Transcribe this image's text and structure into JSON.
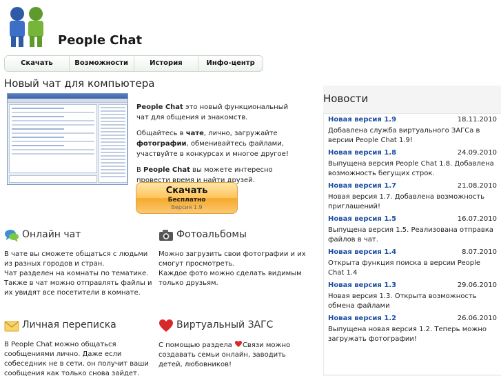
{
  "header": {
    "site_title": "People Chat"
  },
  "nav": {
    "items": [
      "Скачать",
      "Возможности",
      "История",
      "Инфо-центр"
    ]
  },
  "page_heading": "Новый чат для компьютера",
  "intro": {
    "p1_strong": "People Chat",
    "p1_rest": " это новый функциональный чат для общения и знакомств.",
    "p2_a": "Общайтесь в ",
    "p2_b": "чате",
    "p2_c": ", лично, загружайте ",
    "p2_d": "фотографии",
    "p2_e": ", обменивайтесь файлами, участвуйте в конкурсах и многое другое!",
    "p3_a": "В ",
    "p3_b": "People Chat",
    "p3_c": " вы можете интересно провести время и найти друзей."
  },
  "download": {
    "main": "Скачать",
    "sub": "Бесплатно",
    "version": "Версия 1.9"
  },
  "features": {
    "chat": {
      "title": "Онлайн чат",
      "text": "В чате вы сможете общаться с людьми из разных городов и стран.\nЧат разделен на комнаты по тематике.\nТакже в чат можно отправлять файлы и их увидят все посетители в комнате."
    },
    "photos": {
      "title": "Фотоальбомы",
      "text": "Можно загрузить свои фотографии и их смогут просмотреть.\nКаждое фото можно сделать видимым только друзьям."
    },
    "mail": {
      "title": "Личная переписка",
      "text": "В People Chat можно общаться сообщениями лично. Даже если собеседник не в сети, он получит ваши сообщения как только снова зайдет."
    },
    "zags": {
      "title": "Виртуальный ЗАГС",
      "text_a": "С помощью раздела ",
      "text_b": "Связи можно создавать семьи онлайн, заводить детей, любовников!"
    }
  },
  "news": {
    "heading": "Новости",
    "items": [
      {
        "title": "Новая версия 1.9",
        "date": "18.11.2010",
        "text": "Добавлена служба виртуального ЗАГСа в версии People Chat 1.9!"
      },
      {
        "title": "Новая версия 1.8",
        "date": "24.09.2010",
        "text": "Выпущена версия People Chat 1.8. Добавлена возможность бегущих строк."
      },
      {
        "title": "Новая версия 1.7",
        "date": "21.08.2010",
        "text": "Новая версия 1.7. Добавлена возможность приглашений!"
      },
      {
        "title": "Новая версия 1.5",
        "date": "16.07.2010",
        "text": "Выпущена версия 1.5. Реализована отправка файлов в чат."
      },
      {
        "title": "Новая версия 1.4",
        "date": "8.07.2010",
        "text": "Открыта функция поиска в версии People Chat 1.4"
      },
      {
        "title": "Новая версия 1.3",
        "date": "29.06.2010",
        "text": "Новая версия 1.3. Открыта возможность обмена файлами"
      },
      {
        "title": "Новая версия 1.2",
        "date": "26.06.2010",
        "text": "Выпущена новая версия 1.2. Теперь можно загружать фотографии!"
      }
    ]
  },
  "colors": {
    "link": "#1d4ea3",
    "download_button": "#ffc45a",
    "news_background": "#f4f4f4"
  },
  "icons": {
    "logo": "two-people-icon",
    "chat": "chat-bubbles-icon",
    "photos": "camera-icon",
    "mail": "envelope-icon",
    "zags": "heart-icon"
  }
}
